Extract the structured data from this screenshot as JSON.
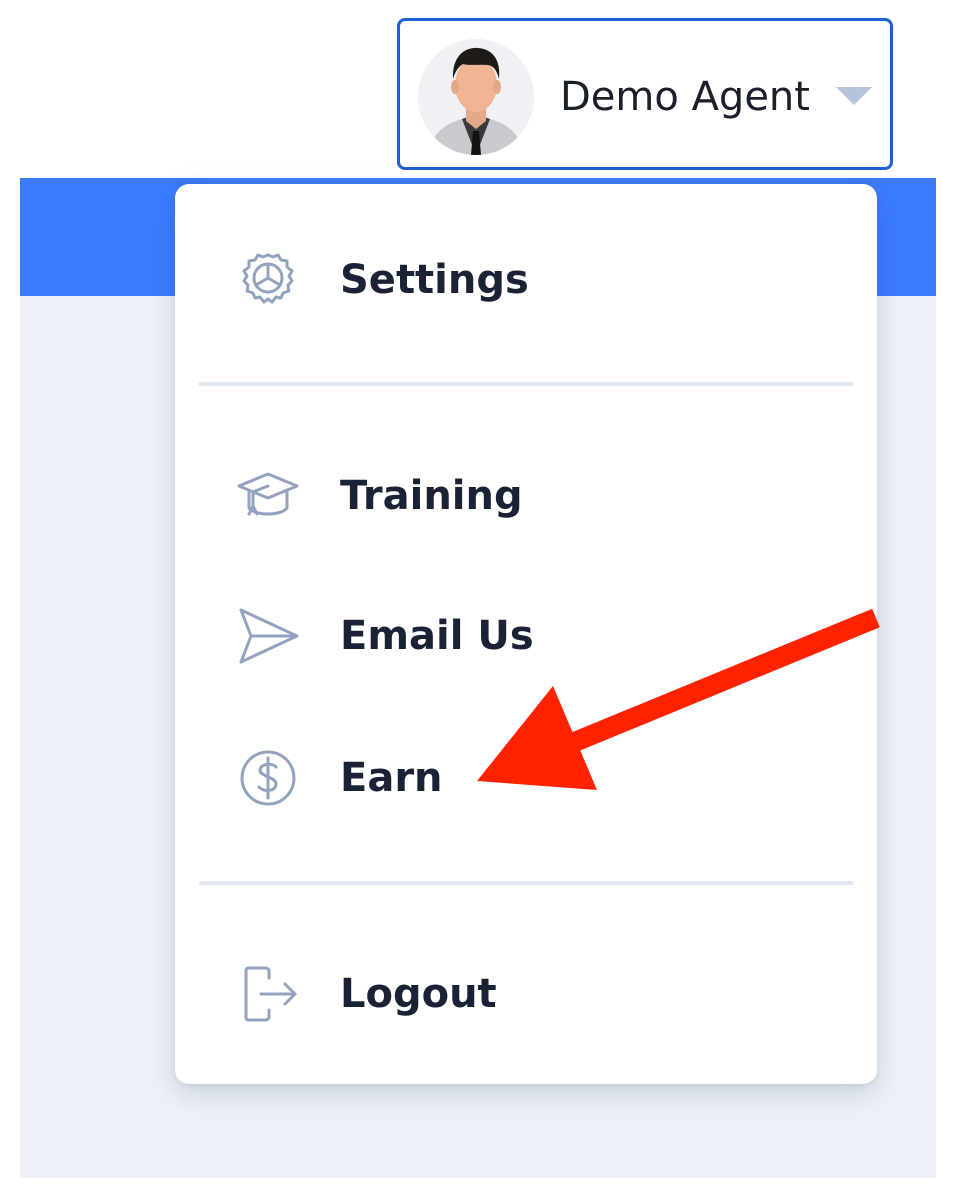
{
  "user": {
    "name": "Demo Agent",
    "avatar_icon": "user-avatar-icon",
    "caret_icon": "caret-down-icon"
  },
  "menu": {
    "items": [
      {
        "label": "Settings",
        "icon": "gear-icon"
      },
      {
        "label": "Training",
        "icon": "graduation-cap-icon"
      },
      {
        "label": "Email Us",
        "icon": "paper-plane-icon"
      },
      {
        "label": "Earn",
        "icon": "dollar-circle-icon"
      },
      {
        "label": "Logout",
        "icon": "logout-icon"
      }
    ]
  },
  "colors": {
    "header_band": "#3d7bff",
    "toggle_border": "#1f5fd6",
    "icon_stroke": "#94a3bd",
    "annotation_arrow": "#ff2200",
    "page_background": "#eef2f8"
  },
  "annotation": {
    "type": "arrow",
    "points_to": "Earn"
  }
}
